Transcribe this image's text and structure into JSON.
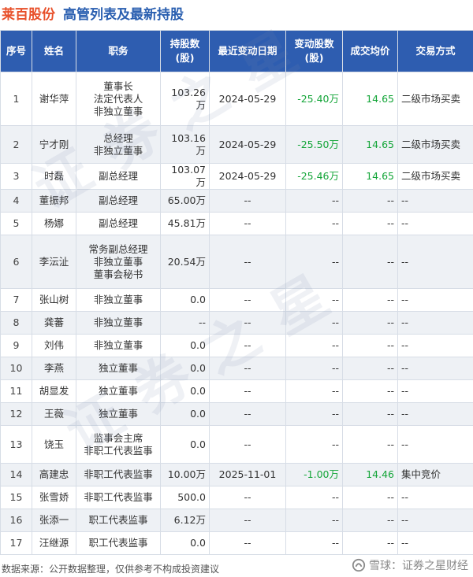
{
  "header": {
    "company": "莱百股份",
    "subtitle": "高管列表及最新持股"
  },
  "table": {
    "columns": [
      "序号",
      "姓名",
      "职务",
      "持股数\n(股)",
      "最近变动日期",
      "变动股数\n(股)",
      "成交均价",
      "交易方式"
    ],
    "rows": [
      {
        "idx": "1",
        "name": "谢华萍",
        "positions": [
          "董事长",
          "法定代表人",
          "非独立董事"
        ],
        "holding": "103.26万",
        "date": "2024-05-29",
        "change": "-25.40万",
        "price": "14.65",
        "mode": "二级市场买卖"
      },
      {
        "idx": "2",
        "name": "宁才刚",
        "positions": [
          "总经理",
          "非独立董事"
        ],
        "holding": "103.16万",
        "date": "2024-05-29",
        "change": "-25.50万",
        "price": "14.65",
        "mode": "二级市场买卖"
      },
      {
        "idx": "3",
        "name": "时磊",
        "positions": [
          "副总经理"
        ],
        "holding": "103.07万",
        "date": "2024-05-29",
        "change": "-25.46万",
        "price": "14.65",
        "mode": "二级市场买卖"
      },
      {
        "idx": "4",
        "name": "董振邦",
        "positions": [
          "副总经理"
        ],
        "holding": "65.00万",
        "date": "--",
        "change": "--",
        "price": "--",
        "mode": "--"
      },
      {
        "idx": "5",
        "name": "杨娜",
        "positions": [
          "副总经理"
        ],
        "holding": "45.81万",
        "date": "--",
        "change": "--",
        "price": "--",
        "mode": "--"
      },
      {
        "idx": "6",
        "name": "李沄沚",
        "positions": [
          "常务副总经理",
          "非独立董事",
          "董事会秘书"
        ],
        "holding": "20.54万",
        "date": "--",
        "change": "--",
        "price": "--",
        "mode": "--"
      },
      {
        "idx": "7",
        "name": "张山树",
        "positions": [
          "非独立董事"
        ],
        "holding": "0.0",
        "date": "--",
        "change": "--",
        "price": "--",
        "mode": "--"
      },
      {
        "idx": "8",
        "name": "龚蕃",
        "positions": [
          "非独立董事"
        ],
        "holding": "--",
        "date": "--",
        "change": "--",
        "price": "--",
        "mode": "--"
      },
      {
        "idx": "9",
        "name": "刘伟",
        "positions": [
          "非独立董事"
        ],
        "holding": "0.0",
        "date": "--",
        "change": "--",
        "price": "--",
        "mode": "--"
      },
      {
        "idx": "10",
        "name": "李燕",
        "positions": [
          "独立董事"
        ],
        "holding": "0.0",
        "date": "--",
        "change": "--",
        "price": "--",
        "mode": "--"
      },
      {
        "idx": "11",
        "name": "胡显发",
        "positions": [
          "独立董事"
        ],
        "holding": "0.0",
        "date": "--",
        "change": "--",
        "price": "--",
        "mode": "--"
      },
      {
        "idx": "12",
        "name": "王薇",
        "positions": [
          "独立董事"
        ],
        "holding": "0.0",
        "date": "--",
        "change": "--",
        "price": "--",
        "mode": "--"
      },
      {
        "idx": "13",
        "name": "饶玉",
        "positions": [
          "监事会主席",
          "非职工代表监事"
        ],
        "holding": "0.0",
        "date": "--",
        "change": "--",
        "price": "--",
        "mode": "--"
      },
      {
        "idx": "14",
        "name": "高建忠",
        "positions": [
          "非职工代表监事"
        ],
        "holding": "10.00万",
        "date": "2025-11-01",
        "change": "-1.00万",
        "price": "14.46",
        "mode": "集中竞价"
      },
      {
        "idx": "15",
        "name": "张雪娇",
        "positions": [
          "非职工代表监事"
        ],
        "holding": "500.0",
        "date": "--",
        "change": "--",
        "price": "--",
        "mode": "--"
      },
      {
        "idx": "16",
        "name": "张添一",
        "positions": [
          "职工代表监事"
        ],
        "holding": "6.12万",
        "date": "--",
        "change": "--",
        "price": "--",
        "mode": "--"
      },
      {
        "idx": "17",
        "name": "汪继源",
        "positions": [
          "职工代表监事"
        ],
        "holding": "0.0",
        "date": "--",
        "change": "--",
        "price": "--",
        "mode": "--"
      }
    ]
  },
  "footer": {
    "source": "数据来源：公开数据整理，仅供参考不构成投资建议",
    "brand": "雪球：证券之星财经"
  },
  "watermark": "证券之星",
  "colors": {
    "company": "#e8502a",
    "subtitle": "#2a5fb0",
    "header_bg": "#2e5db0",
    "positive_green": "#13a538",
    "stripe": "#eef1f5"
  }
}
